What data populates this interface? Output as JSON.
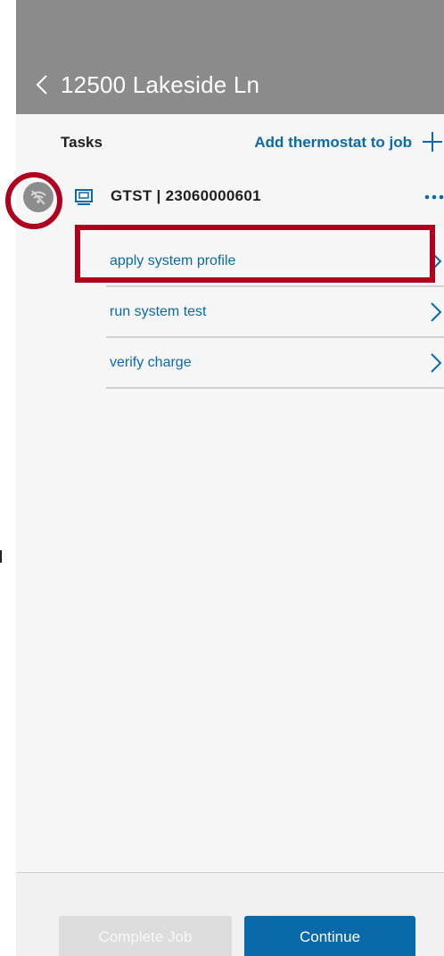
{
  "nav": {
    "title": "12500 Lakeside Ln",
    "back_icon": "chevron-left-icon"
  },
  "tasks_header": {
    "label": "Tasks",
    "add_link": "Add thermostat to job",
    "add_icon": "plus-icon"
  },
  "device": {
    "title": "GTST | 23060000601",
    "status_icon": "wifi-off-icon",
    "device_icon": "thermostat-icon",
    "menu_icon": "more-horizontal-icon"
  },
  "tasks": [
    {
      "label": "apply system profile"
    },
    {
      "label": "run system test"
    },
    {
      "label": "verify charge"
    }
  ],
  "footer": {
    "complete_label": "Complete Job",
    "continue_label": "Continue"
  },
  "colors": {
    "accent": "#0a69a8",
    "header": "#8b8b8b",
    "highlight": "#b00020",
    "disabled_button": "#dcdcdc"
  }
}
